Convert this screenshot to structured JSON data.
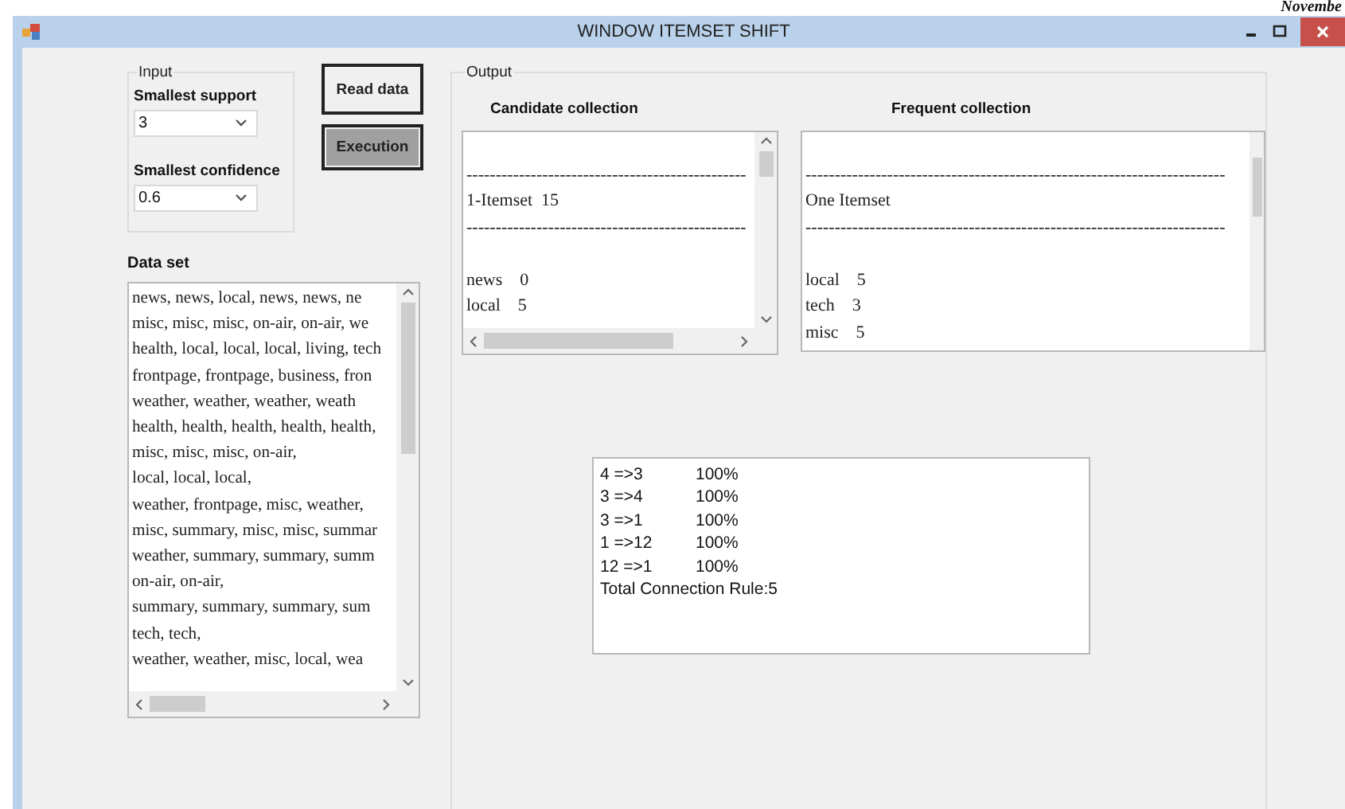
{
  "page_header": "Novembe",
  "window": {
    "title": "WINDOW ITEMSET SHIFT"
  },
  "input": {
    "title": "Input",
    "fields": [
      {
        "label": "Smallest support",
        "value": "3"
      },
      {
        "label": "Smallest confidence",
        "value": "0.6"
      }
    ]
  },
  "buttons": [
    {
      "label": "Read data",
      "selected": false
    },
    {
      "label": "Execution",
      "selected": true
    }
  ],
  "data_set": {
    "label": "Data set",
    "lines": [
      "news, news, local, news, news, ne",
      "misc, misc, misc, on-air, on-air, we",
      "health, local, local, local, living, tech",
      "frontpage, frontpage, business, fron",
      "weather, weather, weather, weath",
      "health, health, health, health, health,",
      "misc, misc, misc, on-air,",
      "local, local, local,",
      "weather, frontpage, misc, weather,",
      "misc, summary, misc, misc, summar",
      "weather, summary, summary, summ",
      "on-air, on-air,",
      "summary, summary, summary, sum",
      "tech, tech,",
      "weather, weather, misc, local, wea"
    ]
  },
  "output": {
    "title": "Output",
    "candidate": {
      "label": "Candidate collection",
      "lines": [
        {
          "kind": "gap"
        },
        {
          "kind": "text",
          "text": "------------------------------------------------"
        },
        {
          "kind": "text",
          "text": "1-Itemset  15"
        },
        {
          "kind": "text",
          "text": "------------------------------------------------"
        },
        {
          "kind": "gap"
        },
        {
          "kind": "text",
          "text": "news    0"
        },
        {
          "kind": "text",
          "text": "local    5"
        }
      ]
    },
    "frequent": {
      "label": "Frequent collection",
      "lines": [
        {
          "kind": "gap"
        },
        {
          "kind": "text",
          "text": "------------------------------------------------------------------------"
        },
        {
          "kind": "text",
          "text": "One Itemset"
        },
        {
          "kind": "text",
          "text": "------------------------------------------------------------------------"
        },
        {
          "kind": "gap"
        },
        {
          "kind": "text",
          "text": "local    5"
        },
        {
          "kind": "text",
          "text": "tech    3"
        },
        {
          "kind": "text",
          "text": "misc    5"
        }
      ]
    },
    "rules": {
      "lines": [
        {
          "rule": "4 =>3",
          "confidence": "100%"
        },
        {
          "rule": "3 =>4",
          "confidence": "100%"
        },
        {
          "rule": "3 =>1",
          "confidence": "100%"
        },
        {
          "rule": "1 =>12",
          "confidence": "100%"
        },
        {
          "rule": "12 =>1",
          "confidence": "100%"
        }
      ],
      "total": "Total Connection Rule:5"
    }
  }
}
